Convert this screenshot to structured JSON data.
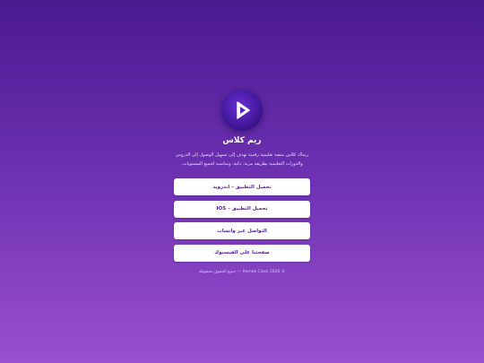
{
  "app": {
    "title": "ريم كلاس",
    "description": "ريماك كلاس منصة تعليمية رقمية تهدف إلى تسهيل الوصول إلى الدروس والدورات التعليمية بطريقة مرنة، ذكية، ومناسبة لجميع المستويات."
  },
  "buttons": {
    "android": "تحميل التطبيق – اندرويد",
    "ios": "تحميل التطبيق – IOS",
    "whatsapp": "التواصل عبر واتساب",
    "facebook": "صفحتنا على الفيسبوك"
  },
  "footer": {
    "text": "© Remek Class 2026 — جميع الحقوق محفوظة"
  },
  "icons": {
    "logo": "play-icon"
  },
  "colors": {
    "background_top": "#4b1a8f",
    "background_bottom": "#9a4fcf",
    "button_text": "#5a1fa3",
    "logo": "#3a138f"
  }
}
